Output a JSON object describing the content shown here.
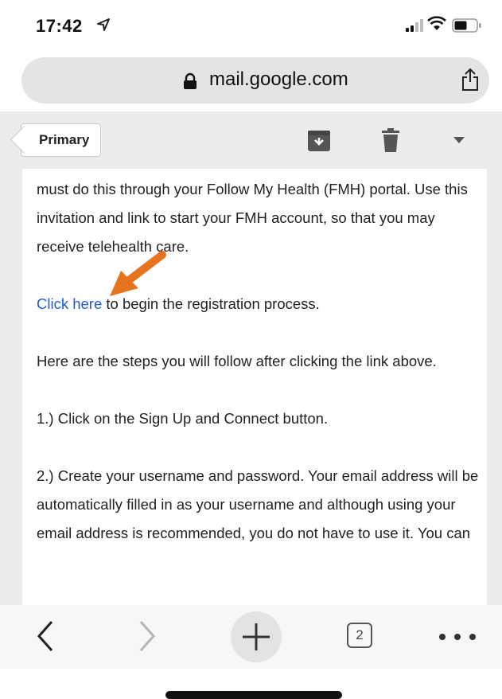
{
  "status_bar": {
    "time": "17:42",
    "icons": [
      "location-arrow-icon",
      "signal-icon",
      "wifi-icon",
      "battery-icon"
    ]
  },
  "browser": {
    "url": "mail.google.com",
    "icons": [
      "lock-icon",
      "share-icon"
    ]
  },
  "gmail_toolbar": {
    "back_label": "Primary",
    "icons": [
      "archive-icon",
      "trash-icon",
      "more-dropdown-icon"
    ]
  },
  "email": {
    "para1": "must do this through your Follow My Health (FMH) portal. Use this invitation and link to start your FMH account, so that you may receive telehealth care.",
    "link_text": "Click here",
    "link_suffix": " to begin the registration process.",
    "para3": "Here are the steps you will follow after clicking the link above.",
    "para4": "1.) Click on the Sign Up and Connect button.",
    "para5": "2.) Create your username and password. Your email address will be automatically filled in as your username and although using your email address is recommended, you do not have to use it. You can",
    "annotation_color": "#e8731f",
    "link_color": "#1a5ed6"
  },
  "bottom_bar": {
    "tab_count": "2",
    "icons": [
      "back-arrow-icon",
      "forward-arrow-icon",
      "plus-icon",
      "tabs-icon",
      "more-dots-icon"
    ]
  }
}
